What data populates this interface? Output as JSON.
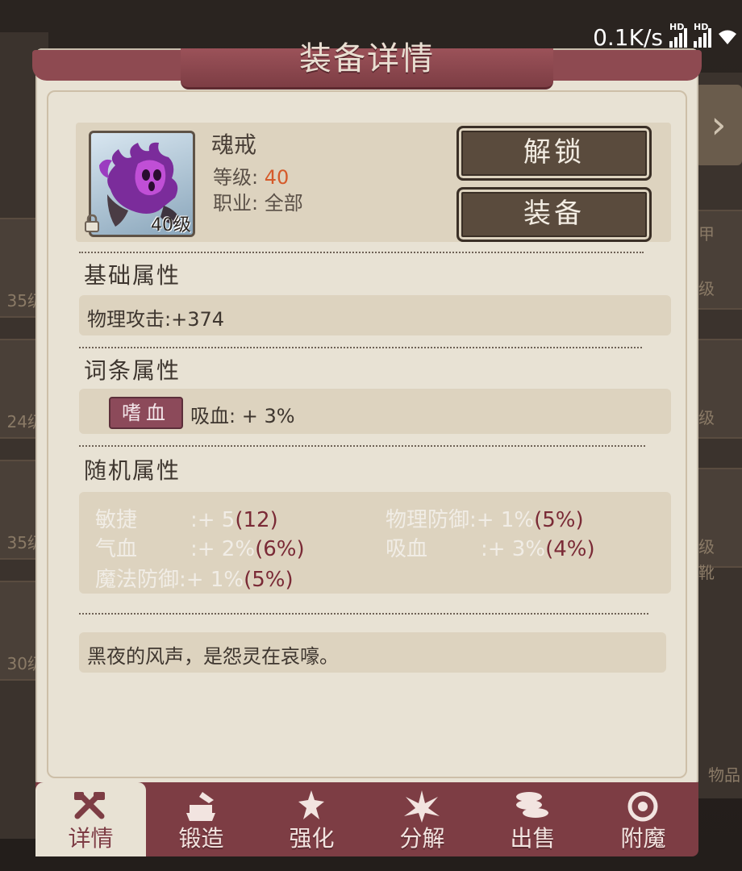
{
  "status_bar": {
    "net_speed": "0.1K/s",
    "hd1": "HD",
    "hd2": "HD",
    "icon": "wifi-icon"
  },
  "background": {
    "left_levels": [
      "35级",
      "24级",
      "35级",
      "30级"
    ],
    "right_levels": [
      "级",
      "甲",
      "级",
      "级",
      "靴"
    ],
    "right_label": "物品"
  },
  "panel": {
    "title": "装备详情",
    "item": {
      "name": "魂戒",
      "level_label": "等级:",
      "level_value": "40",
      "class_label": "职业:",
      "class_value": "全部",
      "icon_level": "40级",
      "icon": "purple-ghost-gear-icon"
    },
    "buttons": {
      "unlock": "解锁",
      "equip": "装备"
    },
    "base": {
      "title": "基础属性",
      "line": "物理攻击:+374"
    },
    "affix": {
      "title": "词条属性",
      "tag": "嗜血",
      "line": "吸血: + 3%"
    },
    "random": {
      "title": "随机属性",
      "left": [
        {
          "name": "敏捷",
          "value": ":+ 5",
          "max": "(12)"
        },
        {
          "name": "气血",
          "value": ":+ 2%",
          "max": "(6%)"
        },
        {
          "name": "魔法防御",
          "value": ":+ 1%",
          "max": "(5%)"
        }
      ],
      "right": [
        {
          "name": "物理防御",
          "value": ":+ 1%",
          "max": "(5%)"
        },
        {
          "name": "吸血",
          "value": ":+ 3%",
          "max": "(4%)"
        }
      ]
    },
    "description": "黑夜的风声，是怨灵在哀嚎。"
  },
  "nav": [
    {
      "label": "详情",
      "icon": "details-icon",
      "active": true
    },
    {
      "label": "锻造",
      "icon": "forge-icon",
      "active": false
    },
    {
      "label": "强化",
      "icon": "enhance-icon",
      "active": false
    },
    {
      "label": "分解",
      "icon": "dismantle-icon",
      "active": false
    },
    {
      "label": "出售",
      "icon": "sell-coins-icon",
      "active": false
    },
    {
      "label": "附魔",
      "icon": "enchant-icon",
      "active": false
    }
  ],
  "colors": {
    "accent": "#7d3d44",
    "level": "#d55a2a",
    "panel": "#e8e2d4",
    "max_value": "#7a2a36"
  }
}
